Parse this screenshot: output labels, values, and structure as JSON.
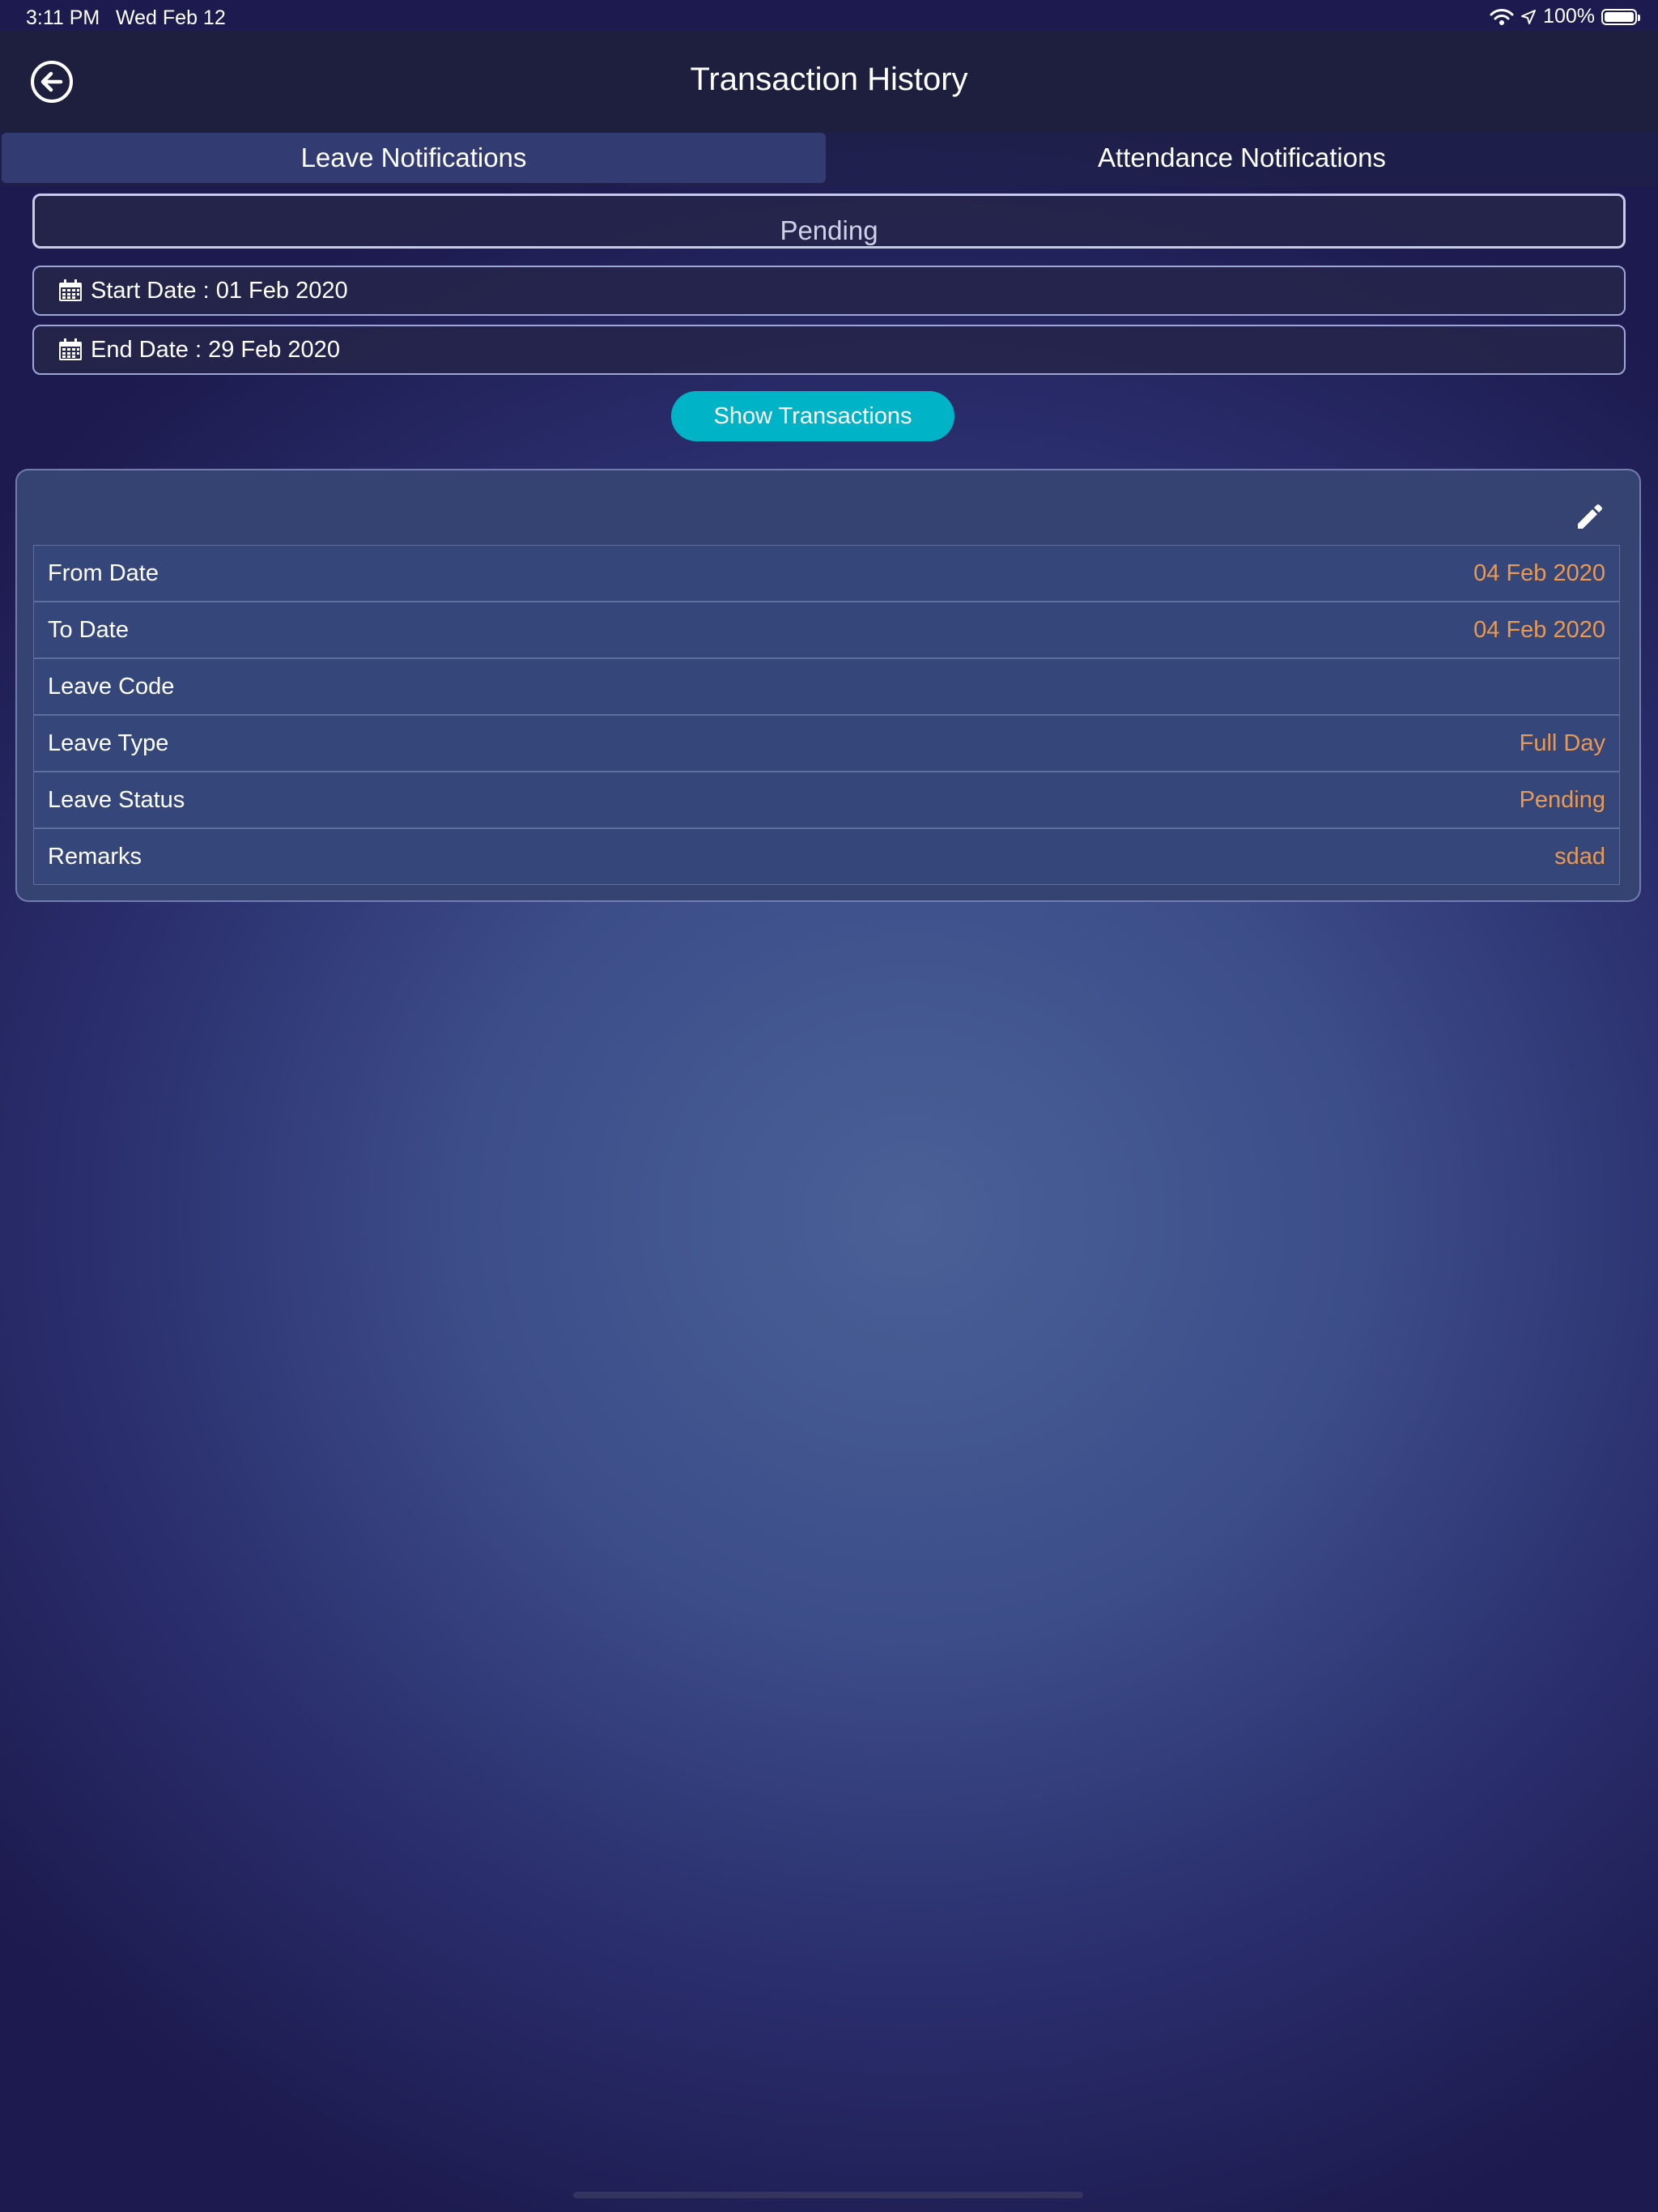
{
  "status_bar": {
    "time": "3:11 PM",
    "date": "Wed Feb 12",
    "battery_percent": "100%",
    "battery_level": 1.0
  },
  "nav": {
    "title": "Transaction History",
    "back_icon": "back-arrow-circle-icon"
  },
  "tabs": [
    {
      "label": "Leave Notifications",
      "active": true
    },
    {
      "label": "Attendance Notifications",
      "active": false
    }
  ],
  "filter": {
    "status_value": "Pending",
    "start_date_label": "Start Date : 01 Feb 2020",
    "end_date_label": "End Date : 29 Feb 2020",
    "calendar_icon": "calendar-icon"
  },
  "show_button_label": "Show Transactions",
  "card": {
    "edit_icon": "pencil-edit-icon",
    "rows": [
      {
        "label": "From Date",
        "value": "04 Feb 2020"
      },
      {
        "label": "To Date",
        "value": "04 Feb 2020"
      },
      {
        "label": "Leave Code",
        "value": ""
      },
      {
        "label": "Leave Type",
        "value": "Full Day"
      },
      {
        "label": "Leave Status",
        "value": "Pending"
      },
      {
        "label": "Remarks",
        "value": "sdad"
      }
    ]
  },
  "colors": {
    "accent_button": "#00b3c7",
    "value_text": "#e89a55",
    "card_background": "#344372"
  }
}
